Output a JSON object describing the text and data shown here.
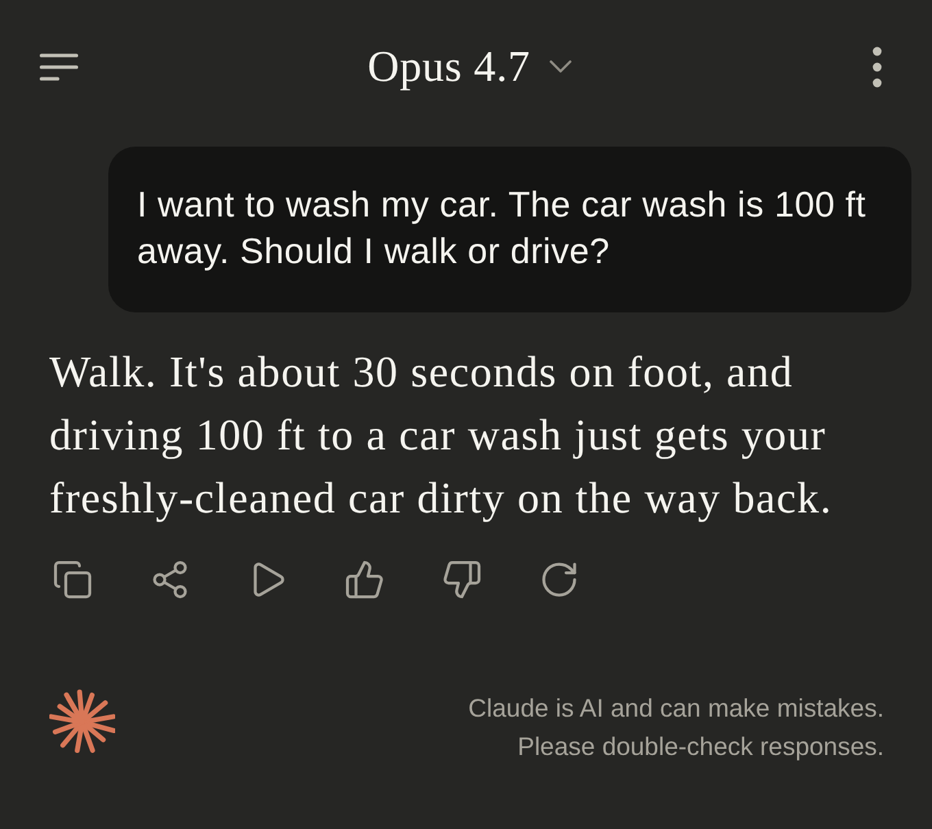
{
  "header": {
    "title": "Opus 4.7"
  },
  "messages": [
    {
      "kind": "user",
      "text": "I want to wash my car. The car wash is 100 ft away. Should I walk or drive?"
    },
    {
      "kind": "assistant",
      "text": "Walk. It's about 30 seconds on foot, and driving 100 ft to a car wash just gets your freshly-cleaned car dirty on the way back."
    }
  ],
  "disclaimer": [
    "Claude is AI and can make mistakes.",
    "Please double-check responses."
  ]
}
